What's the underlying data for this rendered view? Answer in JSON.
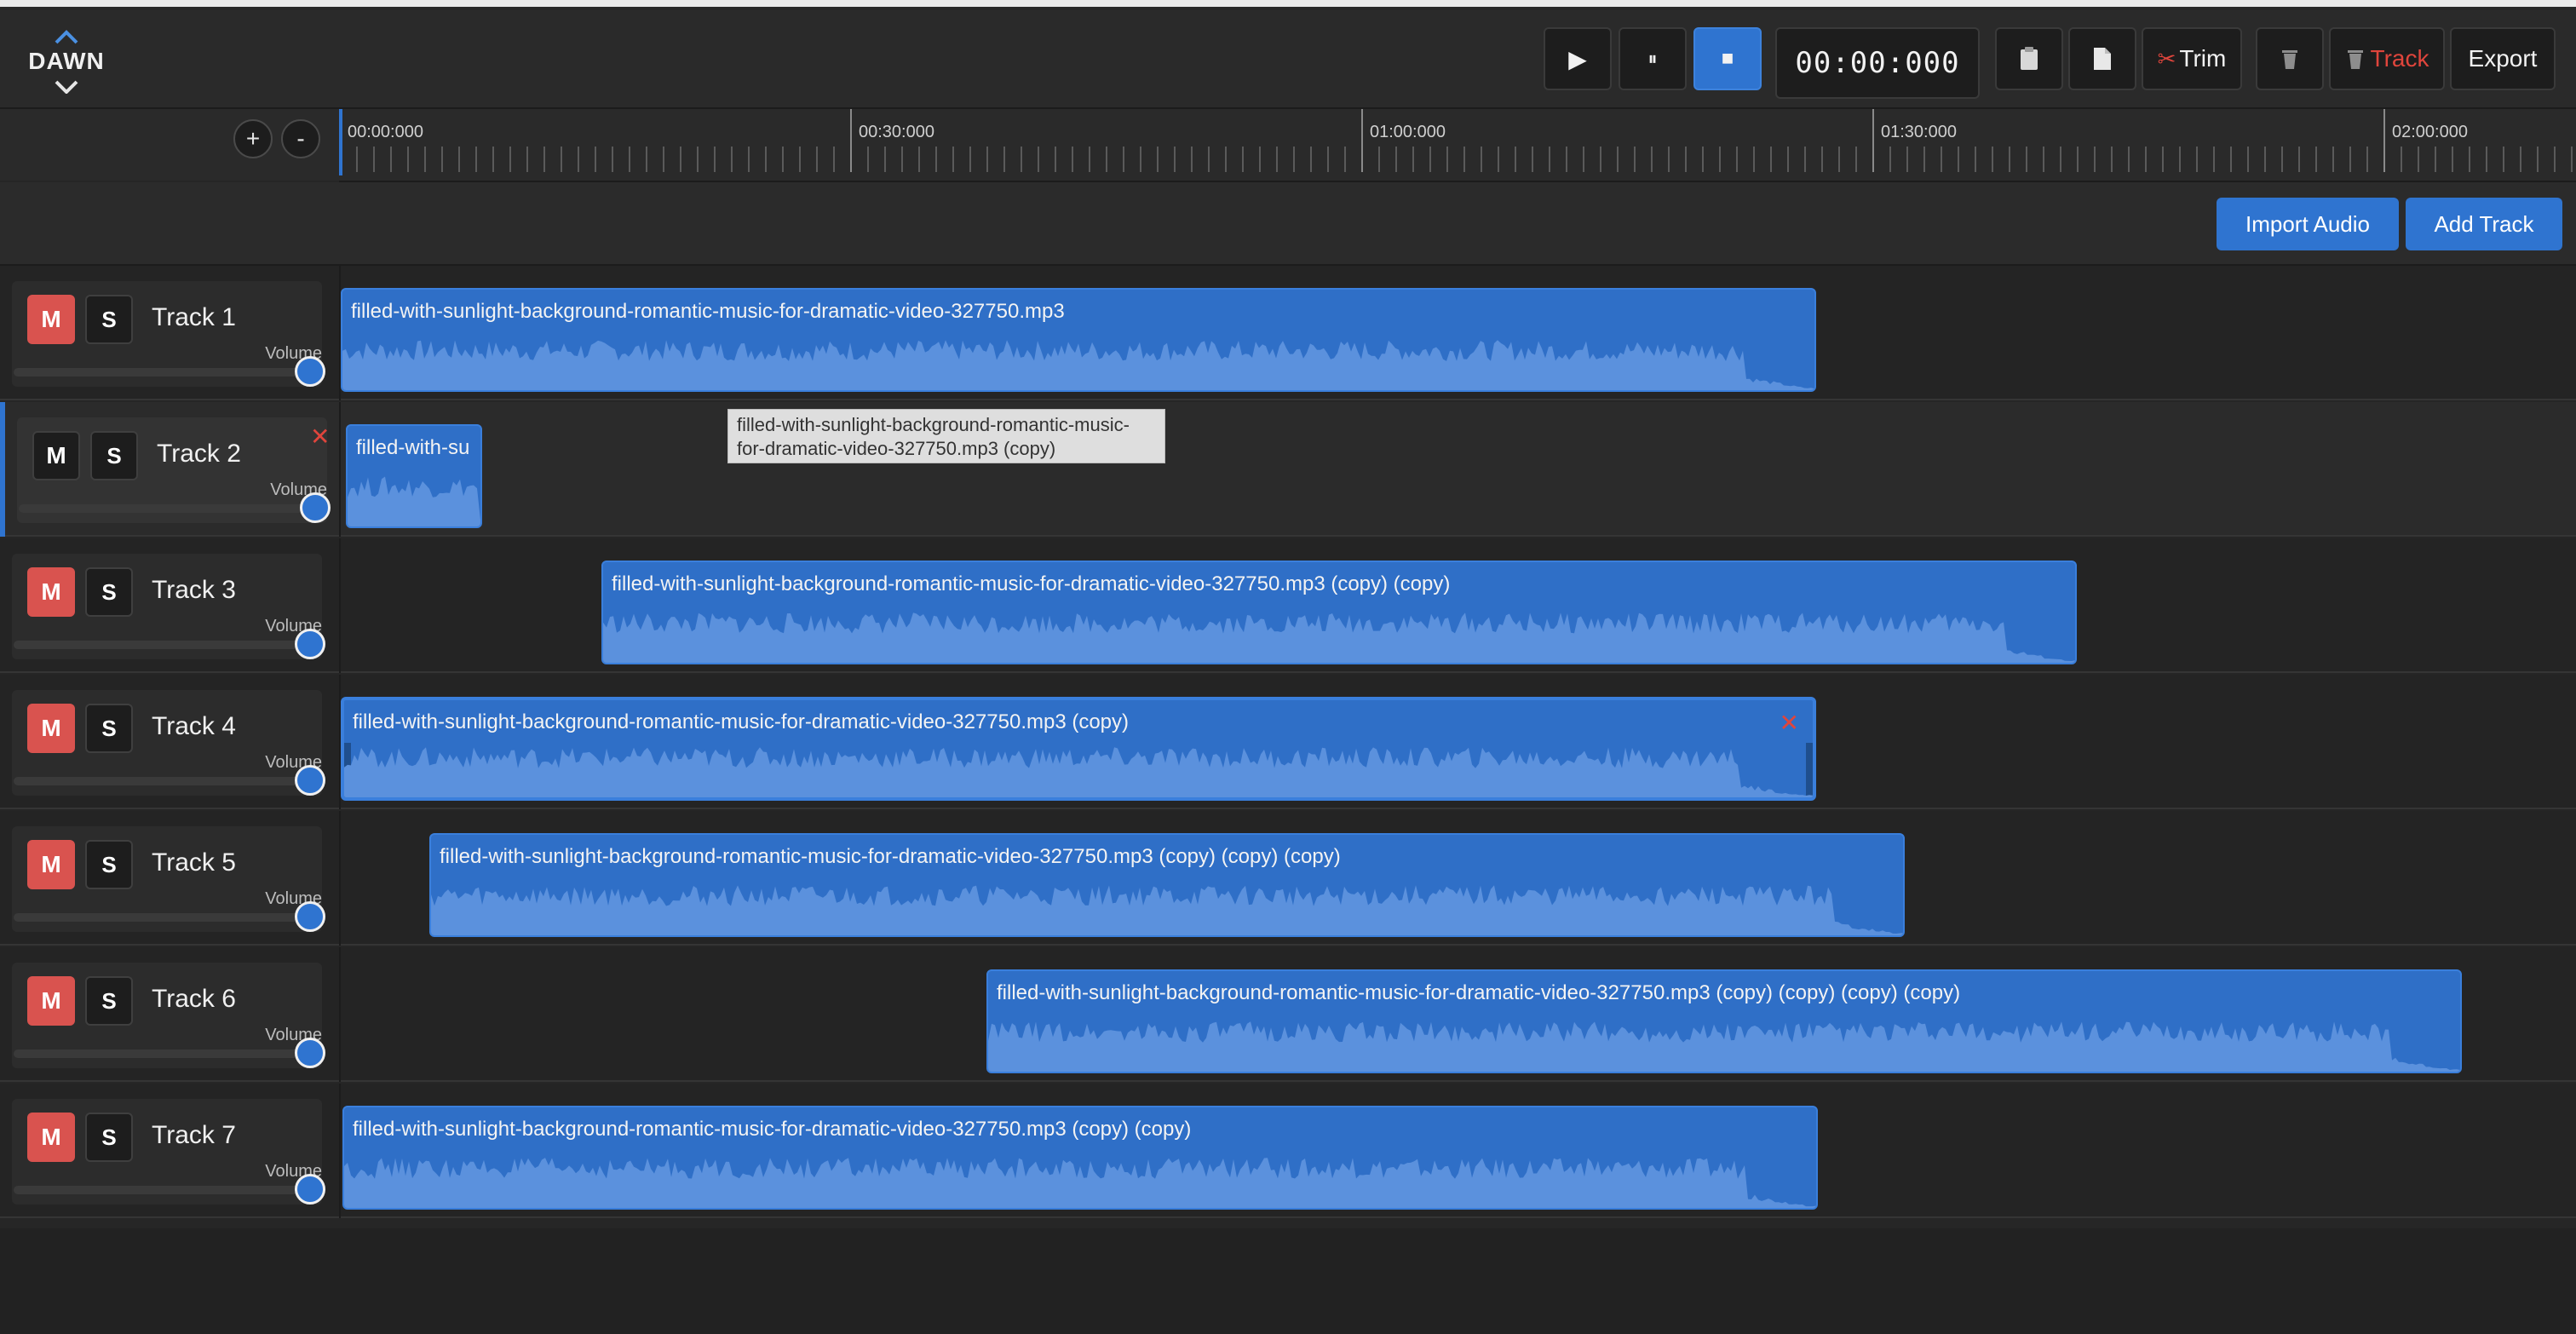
{
  "app": {
    "logo_text": "DAWN"
  },
  "transport": {
    "play": "▶",
    "pause": "⏸",
    "stop": "■",
    "timecode": "00:00:000"
  },
  "toolbar": {
    "paste_icon": "clipboard-icon",
    "new_icon": "document-icon",
    "trim_label": "Trim",
    "delete_icon": "trash-icon",
    "delete_track_label": "Track",
    "export_label": "Export"
  },
  "ruler": {
    "zoom_in": "+",
    "zoom_out": "-",
    "labels": [
      "00:00:000",
      "00:30:000",
      "01:00:000",
      "01:30:000",
      "02:00:000"
    ]
  },
  "actions": {
    "import_label": "Import Audio",
    "add_track_label": "Add Track"
  },
  "volume_label": "Volume",
  "tracks": [
    {
      "name": "Track 1",
      "mute": "M",
      "solo": "S",
      "muted": true,
      "clip": "filled-with-sunlight-background-romantic-music-for-dramatic-video-327750.mp3"
    },
    {
      "name": "Track 2",
      "mute": "M",
      "solo": "S",
      "muted": false,
      "clip": "filled-with-su"
    },
    {
      "name": "Track 3",
      "mute": "M",
      "solo": "S",
      "muted": true,
      "clip": "filled-with-sunlight-background-romantic-music-for-dramatic-video-327750.mp3 (copy) (copy)"
    },
    {
      "name": "Track 4",
      "mute": "M",
      "solo": "S",
      "muted": true,
      "clip": "filled-with-sunlight-background-romantic-music-for-dramatic-video-327750.mp3 (copy)"
    },
    {
      "name": "Track 5",
      "mute": "M",
      "solo": "S",
      "muted": true,
      "clip": "filled-with-sunlight-background-romantic-music-for-dramatic-video-327750.mp3 (copy) (copy) (copy)"
    },
    {
      "name": "Track 6",
      "mute": "M",
      "solo": "S",
      "muted": true,
      "clip": "filled-with-sunlight-background-romantic-music-for-dramatic-video-327750.mp3 (copy) (copy) (copy) (copy)"
    },
    {
      "name": "Track 7",
      "mute": "M",
      "solo": "S",
      "muted": true,
      "clip": "filled-with-sunlight-background-romantic-music-for-dramatic-video-327750.mp3 (copy) (copy)"
    }
  ],
  "tooltip": "filled-with-sunlight-background-romantic-music-for-dramatic-video-327750.mp3 (copy)",
  "colors": {
    "accent": "#2f74d0",
    "mute_active": "#d9534f",
    "danger": "#e0453c"
  }
}
